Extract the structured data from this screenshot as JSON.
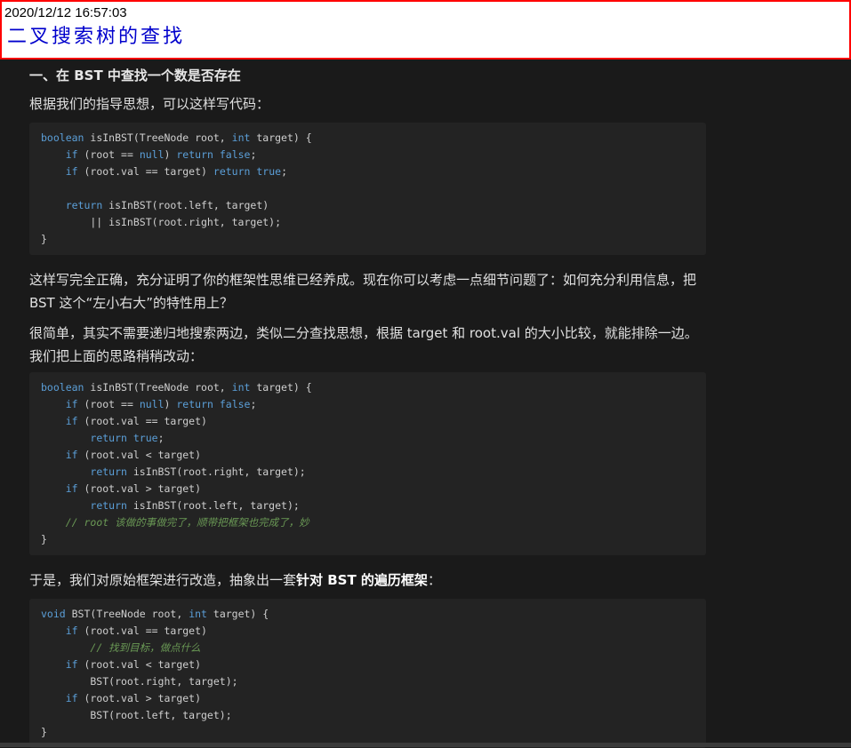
{
  "header": {
    "timestamp": "2020/12/12 16:57:03",
    "title": "二叉搜索树的查找"
  },
  "article": {
    "section_heading": "一、在 BST 中查找一个数是否存在",
    "para1": "根据我们的指导思想，可以这样写代码：",
    "para2": "这样写完全正确，充分证明了你的框架性思维已经养成。现在你可以考虑一点细节问题了：如何充分利用信息，把 BST 这个“左小右大”的特性用上？",
    "para3": "很简单，其实不需要递归地搜索两边，类似二分查找思想，根据 target 和 root.val 的大小比较，就能排除一边。我们把上面的思路稍稍改动：",
    "para4_normal": "于是，我们对原始框架进行改造，抽象出一套",
    "para4_bold": "针对 BST 的遍历框架",
    "para4_end": "："
  },
  "code_blocks": [
    {
      "lines": [
        [
          [
            "kw",
            "boolean"
          ],
          [
            "pl",
            " isInBST(TreeNode root, "
          ],
          [
            "kw",
            "int"
          ],
          [
            "pl",
            " target) {"
          ]
        ],
        [
          [
            "pl",
            "    "
          ],
          [
            "kw",
            "if"
          ],
          [
            "pl",
            " (root == "
          ],
          [
            "kw",
            "null"
          ],
          [
            "pl",
            ") "
          ],
          [
            "kw",
            "return"
          ],
          [
            "pl",
            " "
          ],
          [
            "kw",
            "false"
          ],
          [
            "pl",
            ";"
          ]
        ],
        [
          [
            "pl",
            "    "
          ],
          [
            "kw",
            "if"
          ],
          [
            "pl",
            " (root.val == target) "
          ],
          [
            "kw",
            "return"
          ],
          [
            "pl",
            " "
          ],
          [
            "kw",
            "true"
          ],
          [
            "pl",
            ";"
          ]
        ],
        [
          [
            "pl",
            ""
          ]
        ],
        [
          [
            "pl",
            "    "
          ],
          [
            "kw",
            "return"
          ],
          [
            "pl",
            " isInBST(root.left, target)"
          ]
        ],
        [
          [
            "pl",
            "        || isInBST(root.right, target);"
          ]
        ],
        [
          [
            "pl",
            "}"
          ]
        ]
      ]
    },
    {
      "lines": [
        [
          [
            "kw",
            "boolean"
          ],
          [
            "pl",
            " isInBST(TreeNode root, "
          ],
          [
            "kw",
            "int"
          ],
          [
            "pl",
            " target) {"
          ]
        ],
        [
          [
            "pl",
            "    "
          ],
          [
            "kw",
            "if"
          ],
          [
            "pl",
            " (root == "
          ],
          [
            "kw",
            "null"
          ],
          [
            "pl",
            ") "
          ],
          [
            "kw",
            "return"
          ],
          [
            "pl",
            " "
          ],
          [
            "kw",
            "false"
          ],
          [
            "pl",
            ";"
          ]
        ],
        [
          [
            "pl",
            "    "
          ],
          [
            "kw",
            "if"
          ],
          [
            "pl",
            " (root.val == target)"
          ]
        ],
        [
          [
            "pl",
            "        "
          ],
          [
            "kw",
            "return"
          ],
          [
            "pl",
            " "
          ],
          [
            "kw",
            "true"
          ],
          [
            "pl",
            ";"
          ]
        ],
        [
          [
            "pl",
            "    "
          ],
          [
            "kw",
            "if"
          ],
          [
            "pl",
            " (root.val < target)"
          ]
        ],
        [
          [
            "pl",
            "        "
          ],
          [
            "kw",
            "return"
          ],
          [
            "pl",
            " isInBST(root.right, target);"
          ]
        ],
        [
          [
            "pl",
            "    "
          ],
          [
            "kw",
            "if"
          ],
          [
            "pl",
            " (root.val > target)"
          ]
        ],
        [
          [
            "pl",
            "        "
          ],
          [
            "kw",
            "return"
          ],
          [
            "pl",
            " isInBST(root.left, target);"
          ]
        ],
        [
          [
            "pl",
            "    "
          ],
          [
            "cm",
            "// root 该做的事做完了，顺带把框架也完成了，妙"
          ]
        ],
        [
          [
            "pl",
            "}"
          ]
        ]
      ]
    },
    {
      "lines": [
        [
          [
            "kw",
            "void"
          ],
          [
            "pl",
            " BST(TreeNode root, "
          ],
          [
            "kw",
            "int"
          ],
          [
            "pl",
            " target) {"
          ]
        ],
        [
          [
            "pl",
            "    "
          ],
          [
            "kw",
            "if"
          ],
          [
            "pl",
            " (root.val == target)"
          ]
        ],
        [
          [
            "pl",
            "        "
          ],
          [
            "cm",
            "// 找到目标，做点什么"
          ]
        ],
        [
          [
            "pl",
            "    "
          ],
          [
            "kw",
            "if"
          ],
          [
            "pl",
            " (root.val < target)"
          ]
        ],
        [
          [
            "pl",
            "        BST(root.right, target);"
          ]
        ],
        [
          [
            "pl",
            "    "
          ],
          [
            "kw",
            "if"
          ],
          [
            "pl",
            " (root.val > target)"
          ]
        ],
        [
          [
            "pl",
            "        BST(root.left, target);"
          ]
        ],
        [
          [
            "pl",
            "}"
          ]
        ]
      ]
    }
  ]
}
